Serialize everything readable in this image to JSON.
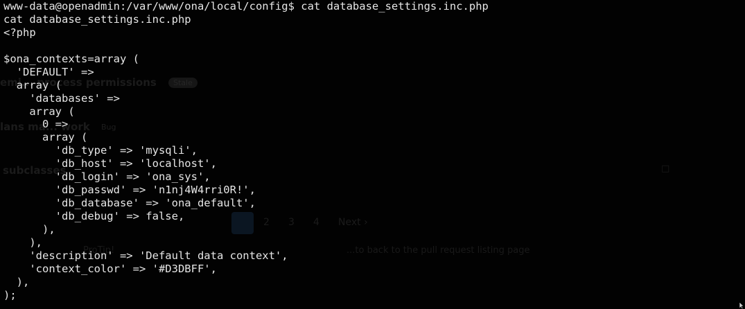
{
  "terminal": {
    "prompt": "www-data@openadmin:/var/www/ona/local/config$",
    "command": "cat database_settings.inc.php",
    "lines": [
      "www-data@openadmin:/var/www/ona/local/config$ cat database_settings.inc.php",
      "cat database_settings.inc.php",
      "<?php",
      "",
      "$ona_contexts=array (",
      "  'DEFAULT' =>",
      "  array (",
      "    'databases' =>",
      "    array (",
      "      0 =>",
      "      array (",
      "        'db_type' => 'mysqli',",
      "        'db_host' => 'localhost',",
      "        'db_login' => 'ona_sys',",
      "        'db_passwd' => 'n1nj4W4rri0R!',",
      "        'db_database' => 'ona_default',",
      "        'db_debug' => false,",
      "      ),",
      "    ),",
      "    'description' => 'Default data context',",
      "    'context_color' => '#D3DBFF',",
      "  ),",
      ");"
    ],
    "colors": {
      "background": "#020202",
      "foreground": "#e6e6e6"
    }
  },
  "ghost": {
    "title1": "emi... process permissions",
    "badge1": "Stale",
    "title2": "lans ma... work",
    "badge2": "Bug",
    "title3": "subclasses",
    "pagination": [
      "2",
      "3",
      "4",
      "Next ›"
    ],
    "tip": "ProTip!",
    "tip_rest": "...to back to the pull request listing page"
  },
  "pointer_icon": "mouse-cursor-icon"
}
